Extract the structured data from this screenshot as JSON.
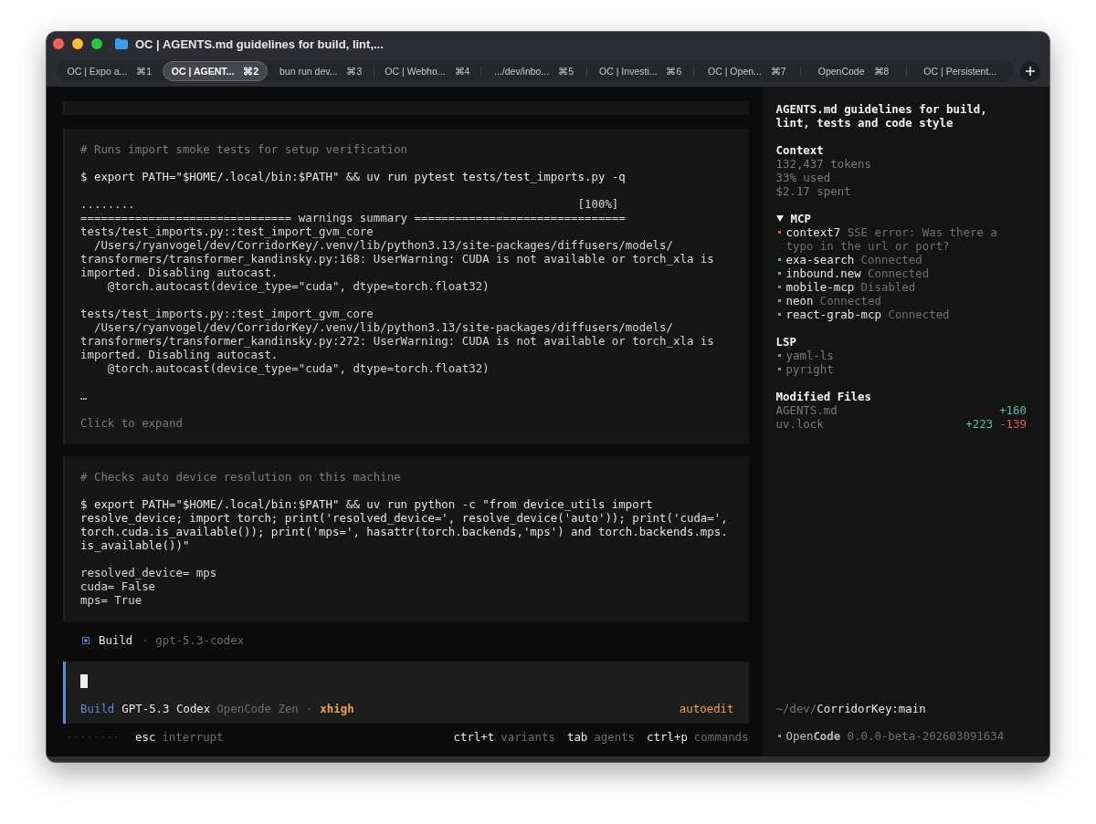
{
  "window": {
    "title": "OC | AGENTS.md guidelines for build, lint,..."
  },
  "tabs": [
    {
      "label": "OC | Expo a...",
      "shortcut": "⌘1",
      "selected": false
    },
    {
      "label": "OC | AGENT...",
      "shortcut": "⌘2",
      "selected": true
    },
    {
      "label": "bun run dev...",
      "shortcut": "⌘3",
      "selected": false
    },
    {
      "label": "OC | Webho...",
      "shortcut": "⌘4",
      "selected": false
    },
    {
      "label": ".../dev/inbo...",
      "shortcut": "⌘5",
      "selected": false
    },
    {
      "label": "OC | Investi...",
      "shortcut": "⌘6",
      "selected": false
    },
    {
      "label": "OC | Open...",
      "shortcut": "⌘7",
      "selected": false
    },
    {
      "label": "OpenCode",
      "shortcut": "⌘8",
      "selected": false
    },
    {
      "label": "OC | Persistent...",
      "selected": false
    }
  ],
  "blocks": [
    {
      "kind": "collapsed"
    },
    {
      "kind": "tool",
      "sections": [
        {
          "kind": "comment",
          "lines": [
            "# Runs import smoke tests for setup verification"
          ]
        },
        {
          "kind": "command",
          "lines": [
            "$ export PATH=\"$HOME/.local/bin:$PATH\" && uv run pytest tests/test_imports.py -q"
          ]
        },
        {
          "kind": "output",
          "lines": [
            "........                                                                 [100%]",
            "=============================== warnings summary ===============================",
            "tests/test_imports.py::test_import_gvm_core",
            "  /Users/ryanvogel/dev/CorridorKey/.venv/lib/python3.13/site-packages/diffusers/models/",
            "transformers/transformer_kandinsky.py:168: UserWarning: CUDA is not available or torch_xla is",
            "imported. Disabling autocast.",
            "    @torch.autocast(device_type=\"cuda\", dtype=torch.float32)"
          ]
        },
        {
          "kind": "output",
          "lines": [
            "tests/test_imports.py::test_import_gvm_core",
            "  /Users/ryanvogel/dev/CorridorKey/.venv/lib/python3.13/site-packages/diffusers/models/",
            "transformers/transformer_kandinsky.py:272: UserWarning: CUDA is not available or torch_xla is",
            "imported. Disabling autocast.",
            "    @torch.autocast(device_type=\"cuda\", dtype=torch.float32)"
          ]
        },
        {
          "kind": "output",
          "lines": [
            "…"
          ]
        },
        {
          "kind": "hint",
          "lines": [
            "Click to expand"
          ]
        }
      ]
    },
    {
      "kind": "tool",
      "sections": [
        {
          "kind": "comment",
          "lines": [
            "# Checks auto device resolution on this machine"
          ]
        },
        {
          "kind": "command",
          "lines": [
            "$ export PATH=\"$HOME/.local/bin:$PATH\" && uv run python -c \"from device_utils import",
            "resolve_device; import torch; print('resolved_device=', resolve_device('auto')); print('cuda=',",
            "torch.cuda.is_available()); print('mps=', hasattr(torch.backends,'mps') and torch.backends.mps.",
            "is_available())\""
          ]
        },
        {
          "kind": "output",
          "lines": [
            "resolved_device= mps",
            "cuda= False",
            "mps= True"
          ]
        }
      ]
    }
  ],
  "agent_line": {
    "agent": "Build",
    "model": "· gpt-5.3-codex"
  },
  "prompt": {
    "agent": "Build",
    "model": "GPT-5.3 Codex",
    "provider": "OpenCode Zen",
    "separator": "·",
    "variant": "xhigh",
    "mode": "autoedit"
  },
  "status_bar": {
    "left": [
      {
        "key": "esc",
        "action": "interrupt"
      }
    ],
    "right": [
      {
        "key": "ctrl+t",
        "action": "variants"
      },
      {
        "key": "tab",
        "action": "agents"
      },
      {
        "key": "ctrl+p",
        "action": "commands"
      }
    ]
  },
  "sidebar": {
    "title": "AGENTS.md guidelines for build, lint, tests and code style",
    "context": {
      "heading": "Context",
      "lines": [
        "132,437 tokens",
        "33% used",
        "$2.17 spent"
      ]
    },
    "mcp": {
      "heading": "MCP",
      "expanded": true,
      "items": [
        {
          "name": "context7",
          "status": "SSE error: Was there a typo in the url or port?",
          "color": "#d9534f"
        },
        {
          "name": "exa-search",
          "status": "Connected",
          "color": "#5cb88a"
        },
        {
          "name": "inbound.new",
          "status": "Connected",
          "color": "#5cb88a"
        },
        {
          "name": "mobile-mcp",
          "status": "Disabled",
          "color": "#8a8a8a"
        },
        {
          "name": "neon",
          "status": "Connected",
          "color": "#5cb88a"
        },
        {
          "name": "react-grab-mcp",
          "status": "Connected",
          "color": "#5cb88a"
        }
      ]
    },
    "lsp": {
      "heading": "LSP",
      "items": [
        {
          "name": "yaml-ls",
          "color": "#6f9c82"
        },
        {
          "name": "pyright",
          "color": "#6f9c82"
        }
      ]
    },
    "modified": {
      "heading": "Modified Files",
      "files": [
        {
          "name": "AGENTS.md",
          "added": "+160"
        },
        {
          "name": "uv.lock",
          "added": "+223",
          "removed": "-139"
        }
      ]
    },
    "path": {
      "prefix": "~/dev/",
      "name": "CorridorKey:main"
    },
    "app": {
      "name": "Open**Code**",
      "version": "0.0.0-beta-202603091634",
      "color": "#5cb88a"
    }
  }
}
